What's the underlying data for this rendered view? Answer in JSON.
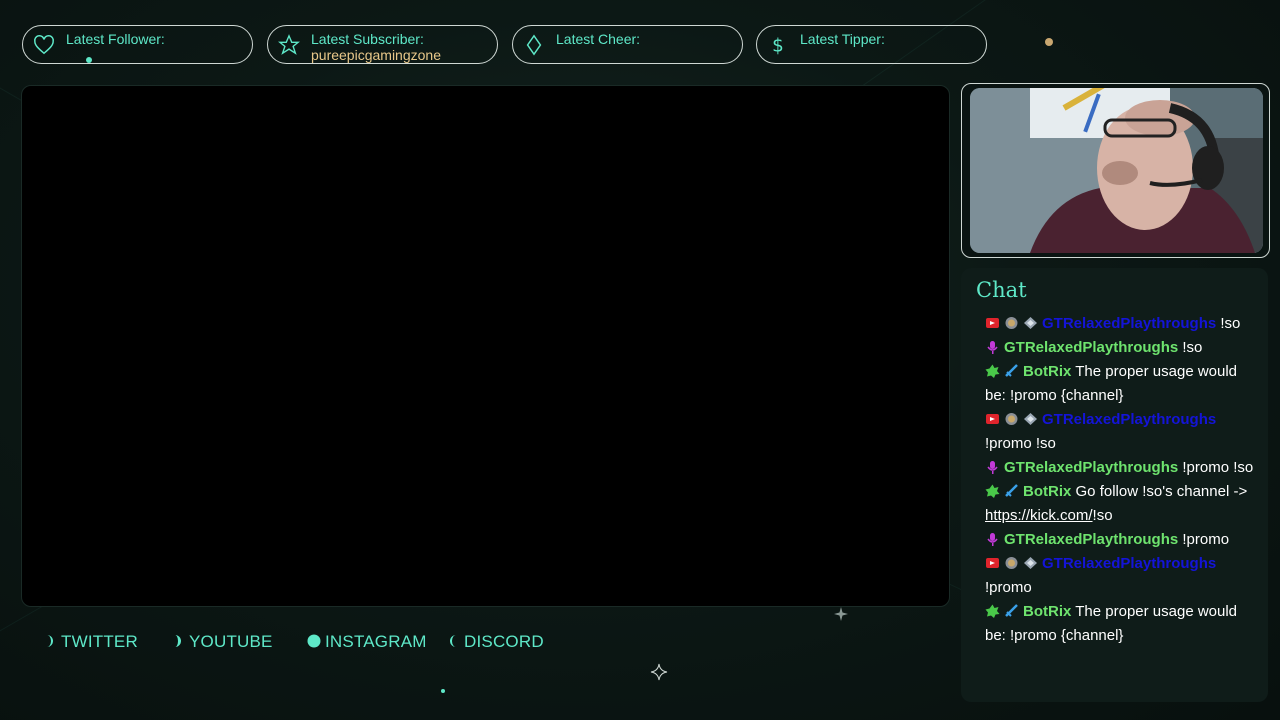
{
  "alerts": {
    "follower": {
      "label": "Latest Follower:",
      "value": ""
    },
    "subscriber": {
      "label": "Latest Subscriber:",
      "value": "pureepicgamingzone"
    },
    "cheer": {
      "label": "Latest Cheer:",
      "value": ""
    },
    "tipper": {
      "label": "Latest Tipper:",
      "value": ""
    }
  },
  "chat": {
    "title": "Chat",
    "messages": [
      {
        "badges": [
          "broadcaster-icon",
          "badge-coin-icon",
          "badge-gem-icon"
        ],
        "user": "GTRelaxedPlaythroughs",
        "user_color": "blue",
        "text": "!so"
      },
      {
        "badges": [
          "mic-icon"
        ],
        "user": "GTRelaxedPlaythroughs",
        "user_color": "green",
        "text": "!so"
      },
      {
        "badges": [
          "bot-badge-icon",
          "sword-icon"
        ],
        "user": "BotRix",
        "user_color": "green",
        "text": "The proper usage would be: !promo {channel}"
      },
      {
        "badges": [
          "broadcaster-icon",
          "badge-coin-icon",
          "badge-gem-icon"
        ],
        "user": "GTRelaxedPlaythroughs",
        "user_color": "blue",
        "text": "!promo !so"
      },
      {
        "badges": [
          "mic-icon"
        ],
        "user": "GTRelaxedPlaythroughs",
        "user_color": "green",
        "text": "!promo !so"
      },
      {
        "badges": [
          "bot-badge-icon",
          "sword-icon"
        ],
        "user": "BotRix",
        "user_color": "green",
        "text": "Go follow !so's channel -> ",
        "link": "https://kick.com/",
        "after_link": "!so"
      },
      {
        "badges": [
          "mic-icon"
        ],
        "user": "GTRelaxedPlaythroughs",
        "user_color": "green",
        "text": "!promo"
      },
      {
        "badges": [
          "broadcaster-icon",
          "badge-coin-icon",
          "badge-gem-icon"
        ],
        "user": "GTRelaxedPlaythroughs",
        "user_color": "blue",
        "text": "!promo"
      },
      {
        "badges": [
          "bot-badge-icon",
          "sword-icon"
        ],
        "user": "BotRix",
        "user_color": "green",
        "text": "The proper usage would be: !promo {channel}"
      }
    ]
  },
  "socials": {
    "twitter": "TWITTER",
    "youtube": "YOUTUBE",
    "instagram": "INSTAGRAM",
    "discord": "DISCORD"
  },
  "colors": {
    "accent": "#5ee8c8",
    "gold": "#e8c88a",
    "chat_green": "#6ee36e",
    "chat_blue": "#1414d8"
  }
}
